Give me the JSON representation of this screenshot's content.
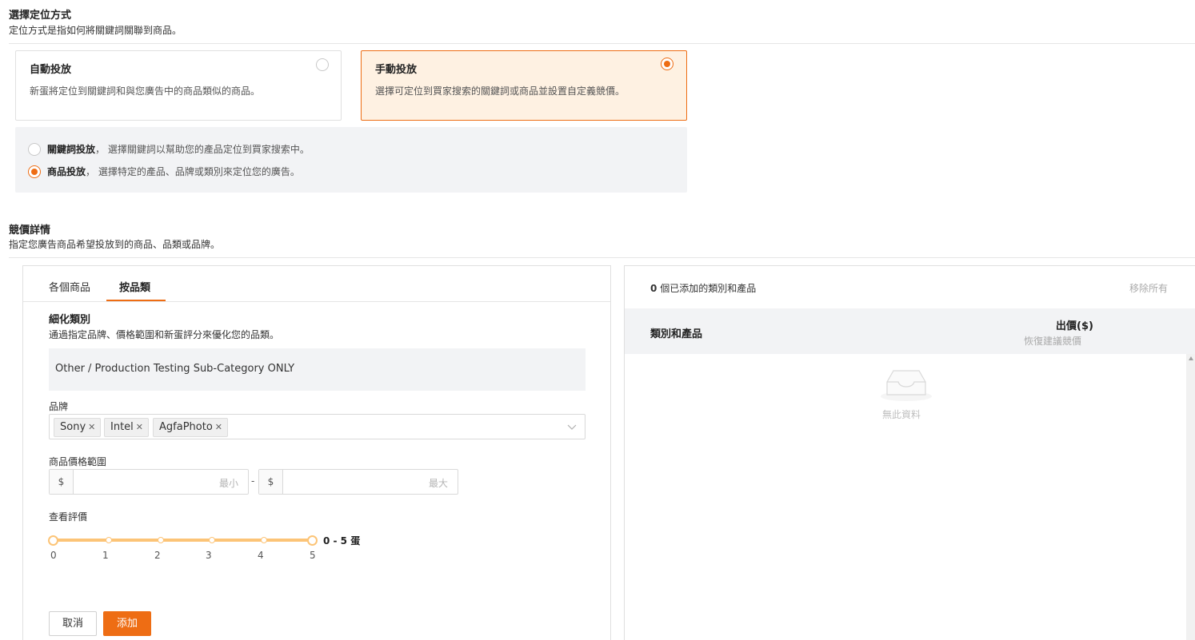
{
  "targeting": {
    "title": "選擇定位方式",
    "subtitle": "定位方式是指如何將關鍵詞關聯到商品。",
    "auto": {
      "title": "自動投放",
      "desc": "新蛋將定位到關鍵詞和與您廣告中的商品類似的商品。",
      "selected": false
    },
    "manual": {
      "title": "手動投放",
      "desc": "選擇可定位到買家搜索的關鍵詞或商品並設置自定義競價。",
      "selected": true
    },
    "options": [
      {
        "label": "關鍵詞投放",
        "sep": "，",
        "desc": "選擇關鍵詞以幫助您的產品定位到買家搜索中。",
        "selected": false
      },
      {
        "label": "商品投放",
        "sep": "，",
        "desc": "選擇特定的產品、品牌或類別來定位您的廣告。",
        "selected": true
      }
    ]
  },
  "bidding": {
    "title": "競價詳情",
    "subtitle": "指定您廣告商品希望投放到的商品、品類或品牌。"
  },
  "left_panel": {
    "tabs": [
      {
        "label": "各個商品",
        "active": false
      },
      {
        "label": "按品類",
        "active": true
      }
    ],
    "refine_title": "細化類別",
    "refine_desc": "通過指定品牌、價格範圍和新蛋評分來優化您的品類。",
    "category": "Other / Production Testing Sub-Category ONLY",
    "brand_label": "品牌",
    "brands": [
      "Sony",
      "Intel",
      "AgfaPhoto"
    ],
    "price_label": "商品價格範圍",
    "currency": "$",
    "price_min_placeholder": "最小",
    "price_max_placeholder": "最大",
    "price_sep": "-",
    "rating_label": "查看評價",
    "rating_ticks": [
      "0",
      "1",
      "2",
      "3",
      "4",
      "5"
    ],
    "rating_range": [
      0,
      5
    ],
    "rating_range_text": "0 - 5 蛋",
    "cancel_label": "取消",
    "add_label": "添加"
  },
  "right_panel": {
    "count": "0",
    "count_text": "個已添加的類別和產品",
    "remove_all": "移除所有",
    "col_category": "類別和產品",
    "col_bid": "出價($)",
    "col_bid_sub": "恢復建議競價",
    "empty_text": "無此資料"
  },
  "colors": {
    "accent": "#ee6d14",
    "accent_light": "#fef1e2",
    "slider": "#fcc477"
  }
}
